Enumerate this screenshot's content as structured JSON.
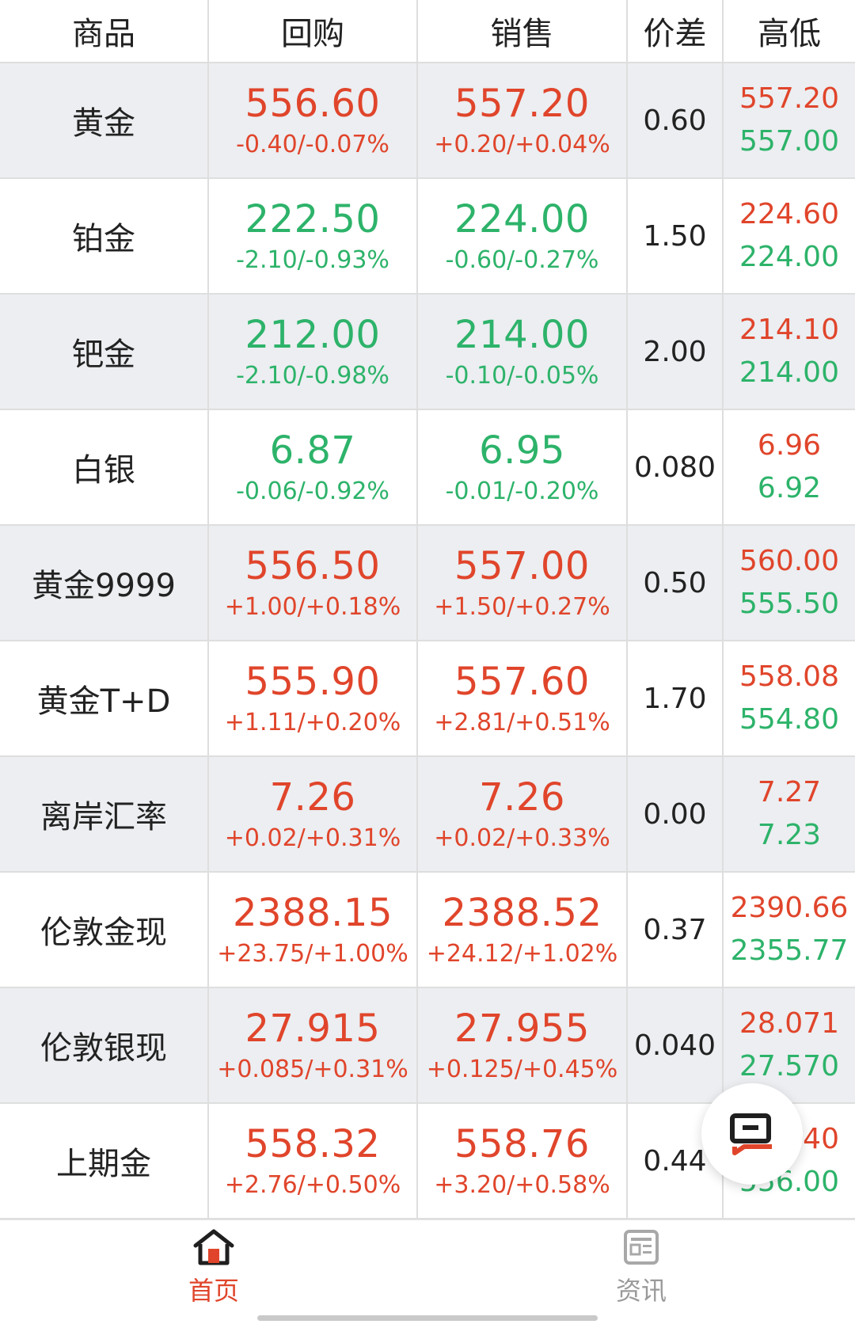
{
  "header": {
    "col_name": "商品",
    "col_buyback": "回购",
    "col_sale": "销售",
    "col_spread": "价差",
    "col_hilo": "高低"
  },
  "colors": {
    "up": "#e0452b",
    "down": "#2db36a",
    "shade": "#eceef1"
  },
  "rows": [
    {
      "name": "黄金",
      "buy": "556.60",
      "buy_chg": "-0.40/-0.07%",
      "buy_dir": "up",
      "sell": "557.20",
      "sell_chg": "+0.20/+0.04%",
      "sell_dir": "up",
      "spread": "0.60",
      "high": "557.20",
      "low": "557.00"
    },
    {
      "name": "铂金",
      "buy": "222.50",
      "buy_chg": "-2.10/-0.93%",
      "buy_dir": "down",
      "sell": "224.00",
      "sell_chg": "-0.60/-0.27%",
      "sell_dir": "down",
      "spread": "1.50",
      "high": "224.60",
      "low": "224.00"
    },
    {
      "name": "钯金",
      "buy": "212.00",
      "buy_chg": "-2.10/-0.98%",
      "buy_dir": "down",
      "sell": "214.00",
      "sell_chg": "-0.10/-0.05%",
      "sell_dir": "down",
      "spread": "2.00",
      "high": "214.10",
      "low": "214.00"
    },
    {
      "name": "白银",
      "buy": "6.87",
      "buy_chg": "-0.06/-0.92%",
      "buy_dir": "down",
      "sell": "6.95",
      "sell_chg": "-0.01/-0.20%",
      "sell_dir": "down",
      "spread": "0.080",
      "high": "6.96",
      "low": "6.92"
    },
    {
      "name": "黄金9999",
      "buy": "556.50",
      "buy_chg": "+1.00/+0.18%",
      "buy_dir": "up",
      "sell": "557.00",
      "sell_chg": "+1.50/+0.27%",
      "sell_dir": "up",
      "spread": "0.50",
      "high": "560.00",
      "low": "555.50"
    },
    {
      "name": "黄金T+D",
      "buy": "555.90",
      "buy_chg": "+1.11/+0.20%",
      "buy_dir": "up",
      "sell": "557.60",
      "sell_chg": "+2.81/+0.51%",
      "sell_dir": "up",
      "spread": "1.70",
      "high": "558.08",
      "low": "554.80"
    },
    {
      "name": "离岸汇率",
      "buy": "7.26",
      "buy_chg": "+0.02/+0.31%",
      "buy_dir": "up",
      "sell": "7.26",
      "sell_chg": "+0.02/+0.33%",
      "sell_dir": "up",
      "spread": "0.00",
      "high": "7.27",
      "low": "7.23"
    },
    {
      "name": "伦敦金现",
      "buy": "2388.15",
      "buy_chg": "+23.75/+1.00%",
      "buy_dir": "up",
      "sell": "2388.52",
      "sell_chg": "+24.12/+1.02%",
      "sell_dir": "up",
      "spread": "0.37",
      "high": "2390.66",
      "low": "2355.77"
    },
    {
      "name": "伦敦银现",
      "buy": "27.915",
      "buy_chg": "+0.085/+0.31%",
      "buy_dir": "up",
      "sell": "27.955",
      "sell_chg": "+0.125/+0.45%",
      "sell_dir": "up",
      "spread": "0.040",
      "high": "28.071",
      "low": "27.570"
    },
    {
      "name": "上期金",
      "buy": "558.32",
      "buy_chg": "+2.76/+0.50%",
      "buy_dir": "up",
      "sell": "558.76",
      "sell_chg": "+3.20/+0.58%",
      "sell_dir": "up",
      "spread": "0.44",
      "high": "558.40",
      "low": "556.00"
    }
  ],
  "bottom_nav": {
    "home_label": "首页",
    "news_label": "资讯",
    "home_icon": "home-icon",
    "news_icon": "news-icon",
    "active": "home"
  },
  "fab": {
    "icon": "chat-icon"
  }
}
